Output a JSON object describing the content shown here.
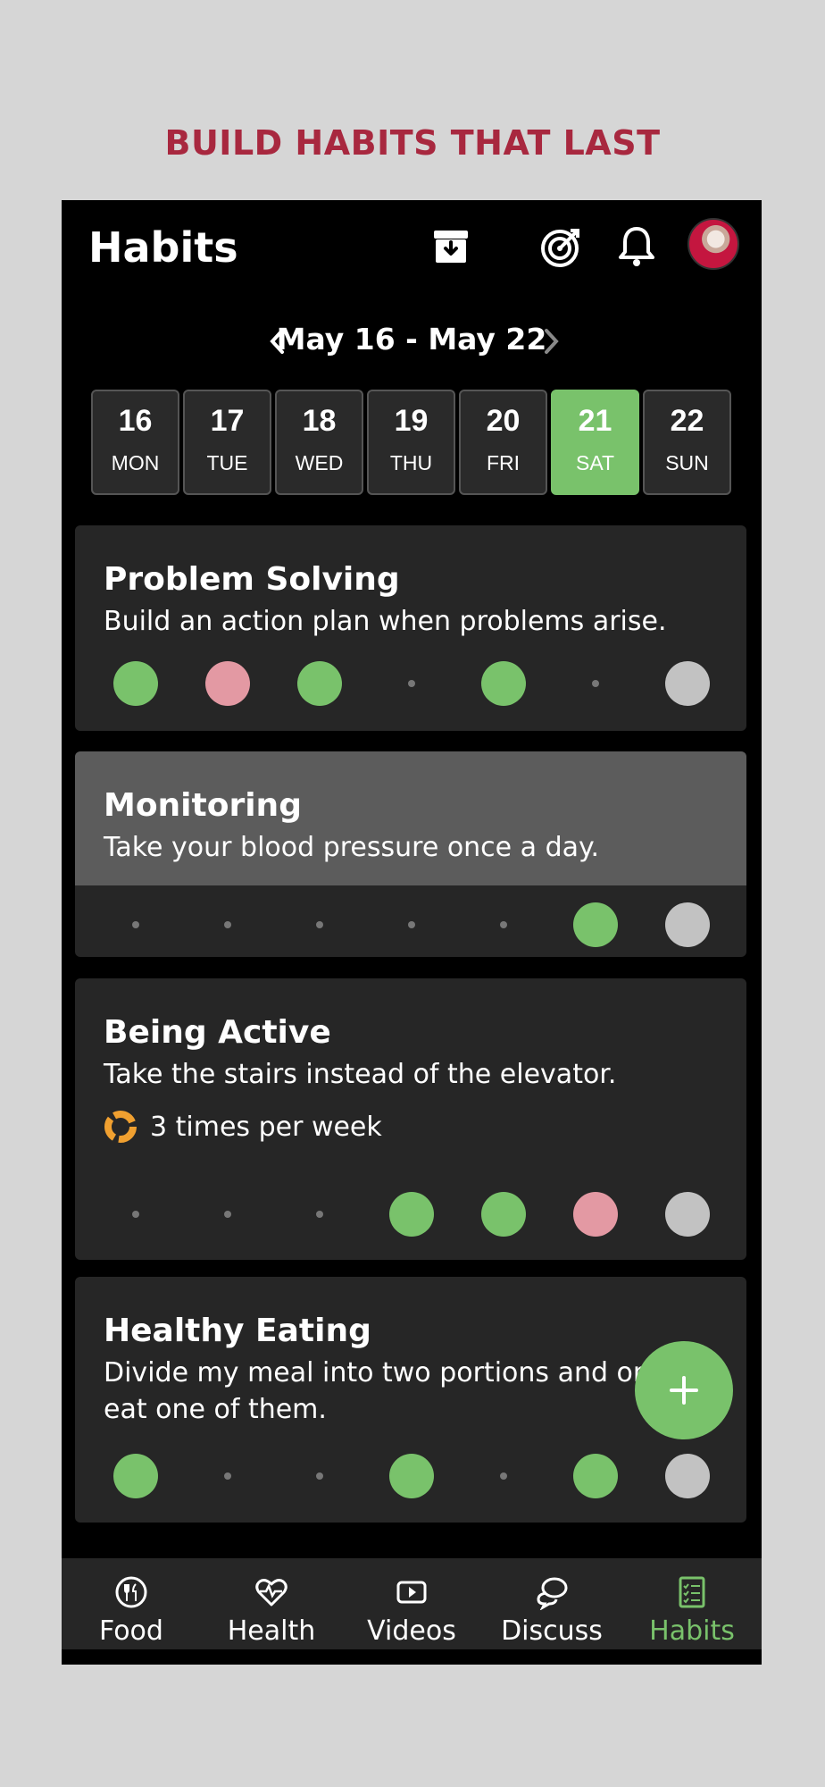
{
  "banner": "BUILD HABITS THAT LAST",
  "header": {
    "title": "Habits",
    "icons": [
      "archive-icon",
      "target-icon",
      "bell-icon",
      "avatar"
    ]
  },
  "week": {
    "label": "May 16 - May 22",
    "days": [
      {
        "num": "16",
        "name": "MON",
        "selected": false
      },
      {
        "num": "17",
        "name": "TUE",
        "selected": false
      },
      {
        "num": "18",
        "name": "WED",
        "selected": false
      },
      {
        "num": "19",
        "name": "THU",
        "selected": false
      },
      {
        "num": "20",
        "name": "FRI",
        "selected": false
      },
      {
        "num": "21",
        "name": "SAT",
        "selected": true
      },
      {
        "num": "22",
        "name": "SUN",
        "selected": false
      }
    ]
  },
  "habits": [
    {
      "title": "Problem Solving",
      "description": "Build an action plan when problems arise.",
      "status": [
        "done",
        "missed",
        "done",
        "none",
        "done",
        "none",
        "pending"
      ]
    },
    {
      "title": "Monitoring",
      "description": "Take your blood pressure once a day.",
      "status": [
        "none",
        "none",
        "none",
        "none",
        "none",
        "done",
        "pending"
      ]
    },
    {
      "title": "Being Active",
      "description": "Take the stairs instead of the elevator.",
      "frequency": "3 times per week",
      "status": [
        "none",
        "none",
        "none",
        "done",
        "done",
        "missed",
        "pending"
      ]
    },
    {
      "title": "Healthy Eating",
      "description": "Divide my meal into two portions and only eat one of them.",
      "status": [
        "done",
        "none",
        "none",
        "done",
        "none",
        "done",
        "pending"
      ]
    }
  ],
  "fab_label": "+",
  "bottom_nav": [
    {
      "label": "Food",
      "icon": "food-icon",
      "active": false
    },
    {
      "label": "Health",
      "icon": "health-icon",
      "active": false
    },
    {
      "label": "Videos",
      "icon": "video-icon",
      "active": false
    },
    {
      "label": "Discuss",
      "icon": "discuss-icon",
      "active": false
    },
    {
      "label": "Habits",
      "icon": "habits-icon",
      "active": true
    }
  ],
  "colors": {
    "accent": "#79c26b",
    "missed": "#e399a3",
    "pending": "#c2c2c2",
    "banner": "#a8283f"
  }
}
